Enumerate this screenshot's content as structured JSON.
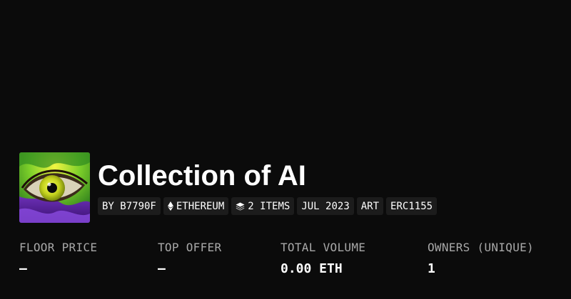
{
  "collection": {
    "title": "Collection of AI",
    "avatar_icon": "eye-artwork-icon",
    "tags": [
      {
        "label": "BY B7790F",
        "icon": null
      },
      {
        "label": "ETHEREUM",
        "icon": "ethereum-icon"
      },
      {
        "label": "2 ITEMS",
        "icon": "layers-icon"
      },
      {
        "label": "JUL 2023",
        "icon": null
      },
      {
        "label": "ART",
        "icon": null
      },
      {
        "label": "ERC1155",
        "icon": null
      }
    ]
  },
  "stats": [
    {
      "label": "FLOOR PRICE",
      "value": "—"
    },
    {
      "label": "TOP OFFER",
      "value": "—"
    },
    {
      "label": "TOTAL VOLUME",
      "value": "0.00 ETH"
    },
    {
      "label": "OWNERS (UNIQUE)",
      "value": "1"
    }
  ],
  "colors": {
    "background": "#0b0b0b",
    "tag_background": "#1c1c1c",
    "label_gray": "#a8a8a8",
    "text": "#ffffff"
  }
}
